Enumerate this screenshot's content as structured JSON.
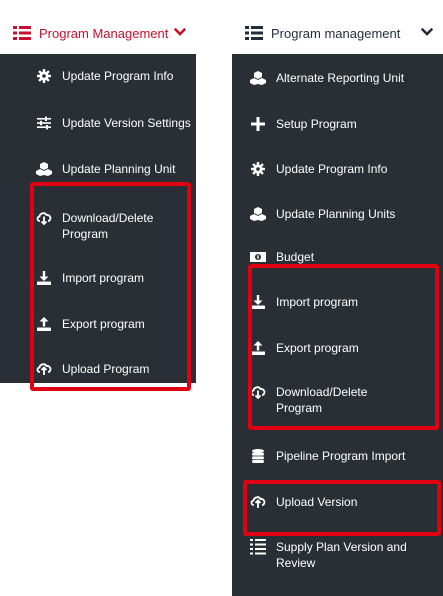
{
  "left_menu": {
    "title": "Program Management",
    "items": [
      {
        "label": "Update Program Info",
        "icon": "gear-icon"
      },
      {
        "label": "Update Version Settings",
        "icon": "sliders-icon"
      },
      {
        "label": "Update Planning Unit",
        "icon": "cubes-icon"
      },
      {
        "label": "Download/Delete\nProgram",
        "icon": "cloud-download-icon"
      },
      {
        "label": "Import program",
        "icon": "download-icon"
      },
      {
        "label": "Export program",
        "icon": "upload-icon"
      },
      {
        "label": "Upload Program",
        "icon": "cloud-upload-icon"
      }
    ]
  },
  "right_menu": {
    "title": "Program management",
    "items": [
      {
        "label": "Alternate Reporting Unit",
        "icon": "cubes-icon"
      },
      {
        "label": "Setup Program",
        "icon": "plus-icon"
      },
      {
        "label": "Update Program Info",
        "icon": "gear-icon"
      },
      {
        "label": "Update Planning Units",
        "icon": "cubes-icon"
      },
      {
        "label": "Budget",
        "icon": "money-icon"
      },
      {
        "label": "Import program",
        "icon": "download-icon"
      },
      {
        "label": "Export program",
        "icon": "upload-icon"
      },
      {
        "label": "Download/Delete\nProgram",
        "icon": "cloud-download-icon"
      },
      {
        "label": "Pipeline Program Import",
        "icon": "database-icon"
      },
      {
        "label": "Upload Version",
        "icon": "cloud-upload-icon"
      },
      {
        "label": "Supply Plan Version and\nReview",
        "icon": "list-icon"
      }
    ]
  },
  "colors": {
    "panel_bg": "#2a2f35",
    "highlight": "#e00012",
    "left_title": "#c8102e",
    "right_title": "#1f2d3d"
  }
}
